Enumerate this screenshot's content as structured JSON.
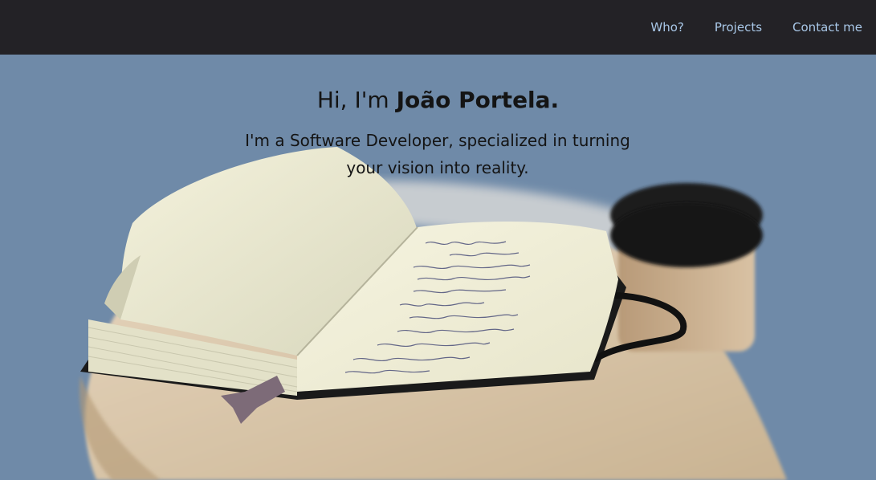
{
  "nav": {
    "items": [
      {
        "label": "Who?"
      },
      {
        "label": "Projects"
      },
      {
        "label": "Contact me"
      }
    ]
  },
  "hero": {
    "greeting_prefix": "Hi, I'm ",
    "name": "João Portela",
    "greeting_suffix": ".",
    "tagline": "I'm a Software Developer, specialized in turning your vision into reality.",
    "background_image": "notebook-on-table-photo"
  },
  "colors": {
    "navbar_bg": "#232226",
    "nav_link": "#a9c8e8",
    "hero_bg": "#6f8aa8",
    "text": "#141414"
  }
}
